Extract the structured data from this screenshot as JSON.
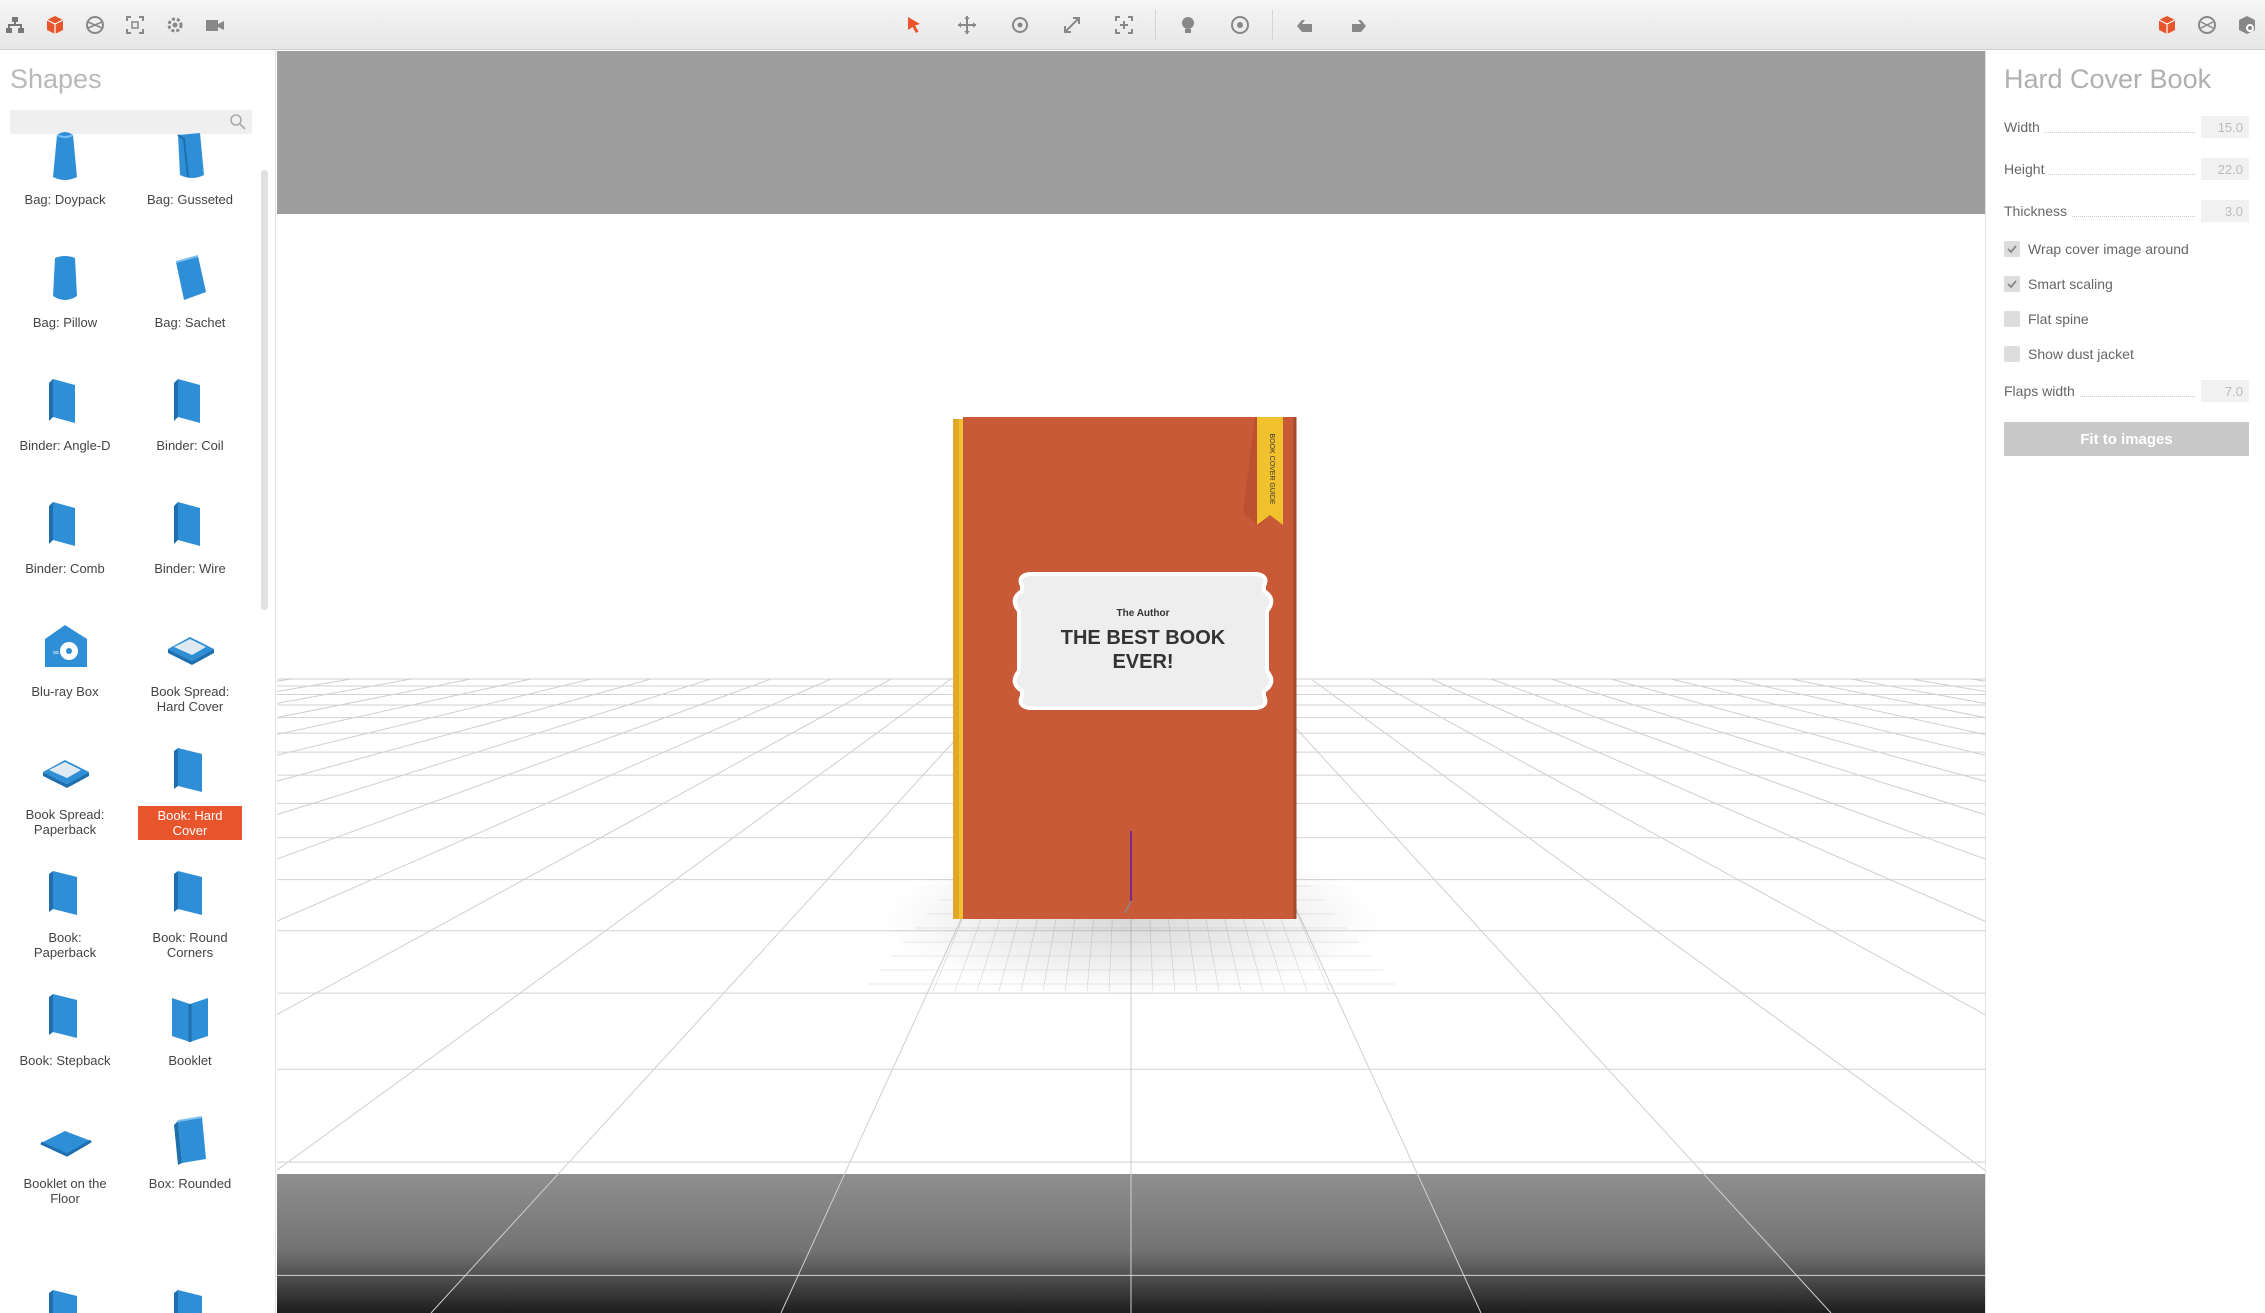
{
  "toolbar": {
    "left_icons": [
      "hierarchy-icon",
      "cube-icon",
      "materials-icon",
      "frame-icon",
      "gear-icon",
      "camera-icon"
    ],
    "center_icons": [
      "select-arrow-icon",
      "move-icon",
      "rotate-icon",
      "scale-icon",
      "fit-view-icon",
      "light-icon",
      "help-icon",
      "undo-icon",
      "redo-icon"
    ],
    "right_icons": [
      "export-cube-icon",
      "render-icon",
      "share-icon"
    ],
    "accent": "#e8542b"
  },
  "sidebar": {
    "title": "Shapes",
    "search_placeholder": "",
    "shapes": [
      {
        "label": "Bag: Doypack",
        "icon": "doypack-icon"
      },
      {
        "label": "Bag: Gusseted",
        "icon": "gusseted-bag-icon"
      },
      {
        "label": "Bag: Pillow",
        "icon": "pillow-bag-icon"
      },
      {
        "label": "Bag: Sachet",
        "icon": "sachet-icon"
      },
      {
        "label": "Binder: Angle-D",
        "icon": "binder-icon"
      },
      {
        "label": "Binder: Coil",
        "icon": "binder-icon"
      },
      {
        "label": "Binder: Comb",
        "icon": "binder-icon"
      },
      {
        "label": "Binder: Wire",
        "icon": "binder-icon"
      },
      {
        "label": "Blu-ray Box",
        "icon": "bluray-icon"
      },
      {
        "label": "Book Spread: Hard Cover",
        "icon": "book-spread-icon"
      },
      {
        "label": "Book Spread: Paperback",
        "icon": "book-spread-icon"
      },
      {
        "label": "Book: Hard Cover",
        "icon": "book-icon",
        "selected": true
      },
      {
        "label": "Book: Paperback",
        "icon": "book-icon"
      },
      {
        "label": "Book: Round Corners",
        "icon": "book-icon"
      },
      {
        "label": "Book: Stepback",
        "icon": "book-icon"
      },
      {
        "label": "Booklet",
        "icon": "booklet-icon"
      },
      {
        "label": "Booklet on the Floor",
        "icon": "booklet-floor-icon"
      },
      {
        "label": "Box: Rounded",
        "icon": "box-icon"
      }
    ]
  },
  "viewport": {
    "book": {
      "author": "The Author",
      "title": "THE BEST BOOK EVER!",
      "ribbon": "BOOK COVER GUIDE",
      "cover_color": "#c85a38",
      "spine_color": "#f2c12e"
    }
  },
  "props": {
    "title": "Hard Cover Book",
    "fields": [
      {
        "label": "Width",
        "value": "15.0"
      },
      {
        "label": "Height",
        "value": "22.0"
      },
      {
        "label": "Thickness",
        "value": "3.0"
      }
    ],
    "checks": [
      {
        "label": "Wrap cover image around",
        "checked": true
      },
      {
        "label": "Smart scaling",
        "checked": true
      },
      {
        "label": "Flat spine",
        "checked": false
      },
      {
        "label": "Show dust jacket",
        "checked": false
      }
    ],
    "flaps": {
      "label": "Flaps width",
      "value": "7.0"
    },
    "fit_button": "Fit to images"
  }
}
